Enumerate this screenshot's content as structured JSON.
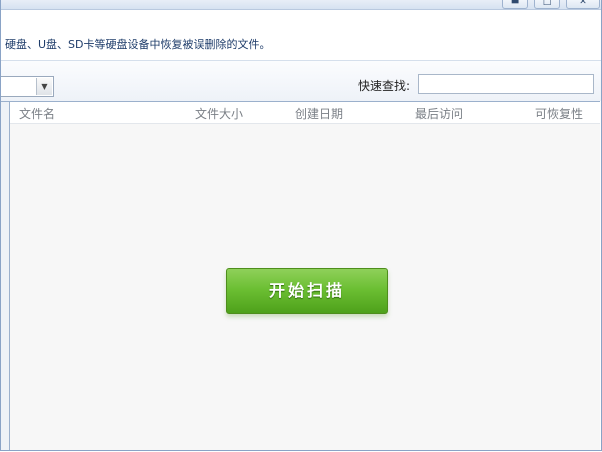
{
  "window": {
    "controls": {
      "minimize_icon": "minimize-icon",
      "maximize_icon": "maximize-icon",
      "close_icon": "close-icon"
    }
  },
  "description": {
    "text": "硬盘、U盘、SD卡等硬盘设备中恢复被误删除的文件。"
  },
  "toolbar": {
    "dropdown": {
      "selected": "",
      "arrow_icon": "dropdown-arrow-icon"
    },
    "search_label": "快速查找:",
    "search_value": "",
    "search_placeholder": ""
  },
  "file_list": {
    "columns": [
      "文件名",
      "文件大小",
      "创建日期",
      "最后访问",
      "可恢复性"
    ],
    "rows": []
  },
  "scan_button": {
    "label": "开始扫描",
    "color": "#5cb426"
  }
}
